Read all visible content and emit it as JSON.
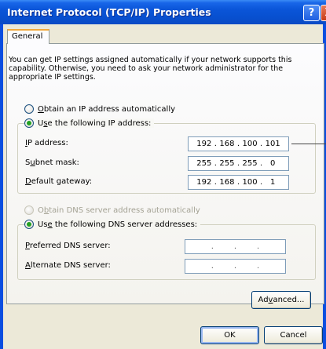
{
  "window": {
    "title": "Internet Protocol (TCP/IP) Properties",
    "help_label": "?",
    "close_label": "X"
  },
  "tab": {
    "label": "General"
  },
  "intro_text": "You can get IP settings assigned automatically if your network supports this capability. Otherwise, you need to ask your network administrator for the appropriate IP settings.",
  "ip_mode": {
    "auto": {
      "prefix": "",
      "accel": "O",
      "rest": "btain an IP address automatically",
      "selected": false
    },
    "manual": {
      "prefix": "U",
      "accel": "s",
      "rest": "e the following IP address:",
      "selected": true
    }
  },
  "ip_fields": [
    {
      "accel": "I",
      "rest": "P address:",
      "octets": [
        "192",
        "168",
        "100",
        "101"
      ]
    },
    {
      "prefix": "S",
      "accel": "u",
      "rest": "bnet mask:",
      "octets": [
        "255",
        "255",
        "255",
        "0"
      ]
    },
    {
      "accel": "D",
      "rest": "efault gateway:",
      "octets": [
        "192",
        "168",
        "100",
        "1"
      ]
    }
  ],
  "dns_mode": {
    "auto": {
      "prefix": "O",
      "accel": "b",
      "rest": "tain DNS server address automatically",
      "selected": false,
      "enabled": false
    },
    "manual": {
      "prefix": "Us",
      "accel": "e",
      "rest": " the following DNS server addresses:",
      "selected": true
    }
  },
  "dns_fields": [
    {
      "accel": "P",
      "rest": "referred DNS server:",
      "octets": [
        "",
        "",
        "",
        ""
      ]
    },
    {
      "accel": "A",
      "rest": "lternate DNS server:",
      "octets": [
        "",
        "",
        "",
        ""
      ]
    }
  ],
  "buttons": {
    "advanced": {
      "prefix": "Ad",
      "accel": "v",
      "rest": "anced..."
    },
    "ok": "OK",
    "cancel": "Cancel"
  }
}
